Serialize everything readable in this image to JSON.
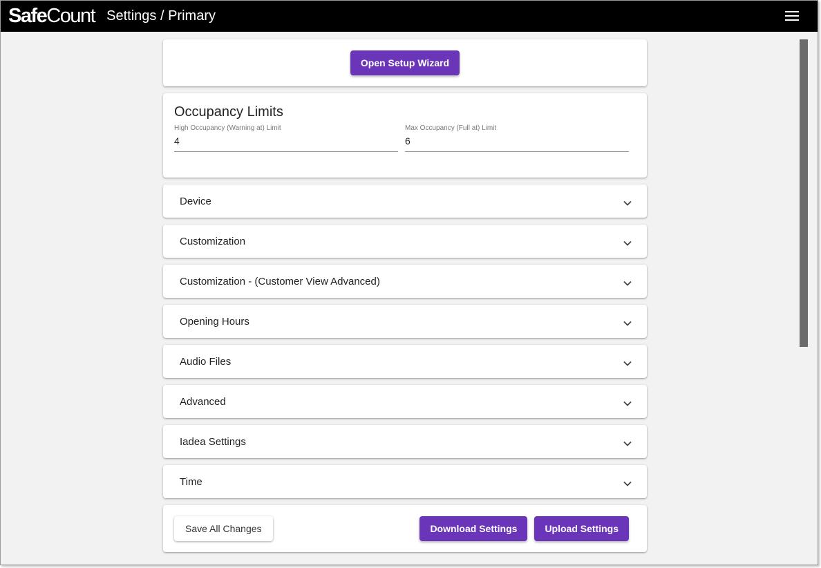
{
  "app": {
    "logo_bold": "Safe",
    "logo_regular": "Count",
    "title": "Settings / Primary"
  },
  "wizard": {
    "button_label": "Open Setup Wizard"
  },
  "occupancy": {
    "heading": "Occupancy Limits",
    "high_label": "High Occupancy (Warning at) Limit",
    "high_value": "4",
    "max_label": "Max Occupancy (Full at) Limit",
    "max_value": "6"
  },
  "panels": [
    {
      "label": "Device"
    },
    {
      "label": "Customization"
    },
    {
      "label": "Customization - (Customer View Advanced)"
    },
    {
      "label": "Opening Hours"
    },
    {
      "label": "Audio Files"
    },
    {
      "label": "Advanced"
    },
    {
      "label": "Iadea Settings"
    },
    {
      "label": "Time"
    }
  ],
  "actions": {
    "save_label": "Save All Changes",
    "download_label": "Download Settings",
    "upload_label": "Upload Settings"
  },
  "colors": {
    "accent": "#6a35b8",
    "appbar": "#000000",
    "background": "#f2f2f2"
  },
  "icons": {
    "menu": "menu-icon",
    "expand": "chevron-down-icon"
  }
}
